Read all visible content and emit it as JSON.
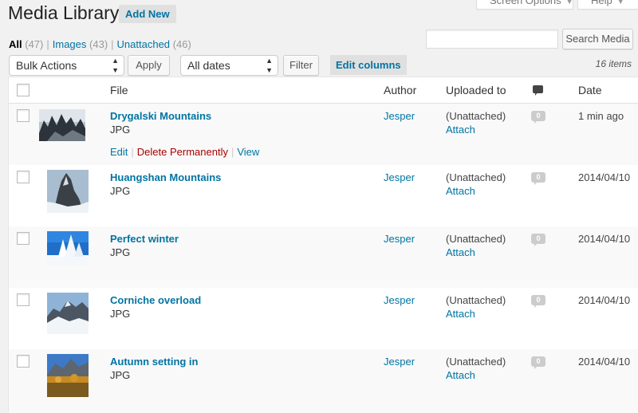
{
  "colors": {
    "link": "#0074a2",
    "delete": "#a00",
    "background": "#f1f1f1"
  },
  "screen_meta": {
    "screen_options": "Screen Options",
    "help": "Help"
  },
  "header": {
    "title": "Media Library",
    "add_new": "Add New"
  },
  "filters": {
    "all_label": "All",
    "all_count": "(47)",
    "images_label": "Images",
    "images_count": "(43)",
    "unattached_label": "Unattached",
    "unattached_count": "(46)",
    "separator": "|"
  },
  "search": {
    "value": "",
    "button": "Search Media"
  },
  "toolbar": {
    "bulk_actions": "Bulk Actions",
    "apply": "Apply",
    "dates": "All dates",
    "filter": "Filter",
    "edit_columns": "Edit columns",
    "items_count": "16 items"
  },
  "table": {
    "columns": {
      "file": "File",
      "author": "Author",
      "uploaded_to": "Uploaded to",
      "comments_icon": "comment-icon",
      "date": "Date"
    },
    "row_actions": {
      "edit": "Edit",
      "delete": "Delete Permanently",
      "view": "View",
      "separator": "|"
    },
    "rows": [
      {
        "title": "Drygalski Mountains",
        "type": "JPG",
        "author": "Jesper",
        "uploaded": "(Unattached)",
        "attach": "Attach",
        "comments": "0",
        "date": "1 min ago"
      },
      {
        "title": "Huangshan Mountains",
        "type": "JPG",
        "author": "Jesper",
        "uploaded": "(Unattached)",
        "attach": "Attach",
        "comments": "0",
        "date": "2014/04/10"
      },
      {
        "title": "Perfect winter",
        "type": "JPG",
        "author": "Jesper",
        "uploaded": "(Unattached)",
        "attach": "Attach",
        "comments": "0",
        "date": "2014/04/10"
      },
      {
        "title": "Corniche overload",
        "type": "JPG",
        "author": "Jesper",
        "uploaded": "(Unattached)",
        "attach": "Attach",
        "comments": "0",
        "date": "2014/04/10"
      },
      {
        "title": "Autumn setting in",
        "type": "JPG",
        "author": "Jesper",
        "uploaded": "(Unattached)",
        "attach": "Attach",
        "comments": "0",
        "date": "2014/04/10"
      }
    ]
  }
}
